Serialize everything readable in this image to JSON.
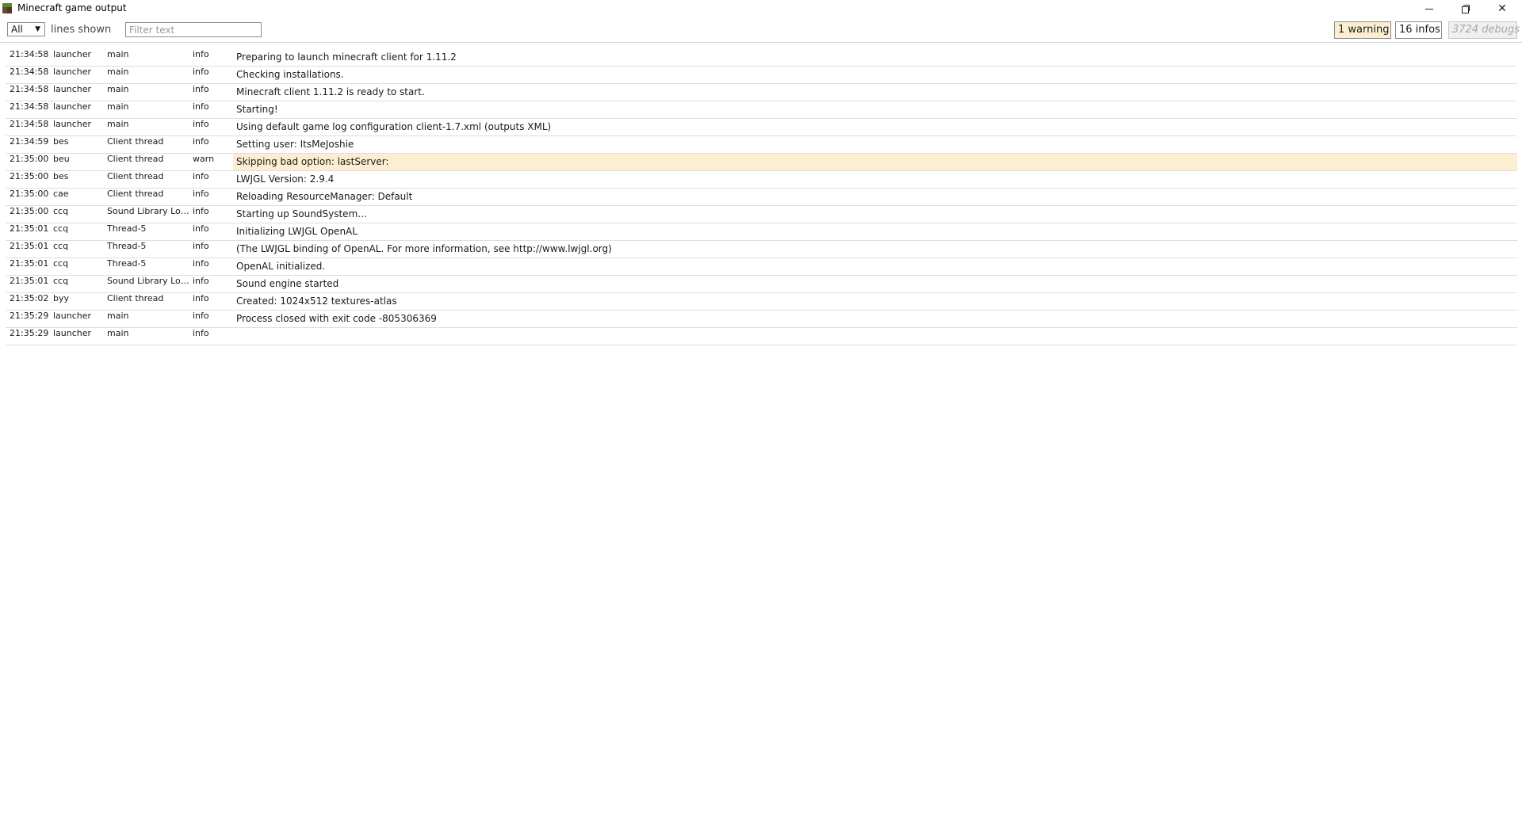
{
  "window": {
    "title": "Minecraft game output",
    "controls": {
      "minimize": "minimize",
      "restore": "restore",
      "close": "✕"
    }
  },
  "toolbar": {
    "lines_select_value": "All",
    "lines_select_arrow": "▼",
    "lines_shown_label": "lines shown",
    "filter_placeholder": "Filter text",
    "warnings_label": "1 warning",
    "infos_label": "16 infos",
    "debugs_label": "3724 debugs"
  },
  "colors": {
    "warning_highlight": "#fcefd1",
    "row_divider": "#dedede"
  },
  "log": {
    "rows": [
      {
        "time": "21:34:58",
        "source": "launcher",
        "thread": "main",
        "level": "info",
        "message": "Preparing to launch minecraft client for 1.11.2"
      },
      {
        "time": "21:34:58",
        "source": "launcher",
        "thread": "main",
        "level": "info",
        "message": "Checking installations."
      },
      {
        "time": "21:34:58",
        "source": "launcher",
        "thread": "main",
        "level": "info",
        "message": "Minecraft client 1.11.2 is ready to start."
      },
      {
        "time": "21:34:58",
        "source": "launcher",
        "thread": "main",
        "level": "info",
        "message": "Starting!"
      },
      {
        "time": "21:34:58",
        "source": "launcher",
        "thread": "main",
        "level": "info",
        "message": "Using default game log configuration client-1.7.xml (outputs XML)"
      },
      {
        "time": "21:34:59",
        "source": "bes",
        "thread": "Client thread",
        "level": "info",
        "message": "Setting user: ItsMeJoshie"
      },
      {
        "time": "21:35:00",
        "source": "beu",
        "thread": "Client thread",
        "level": "warn",
        "message": "Skipping bad option: lastServer:"
      },
      {
        "time": "21:35:00",
        "source": "bes",
        "thread": "Client thread",
        "level": "info",
        "message": "LWJGL Version: 2.9.4"
      },
      {
        "time": "21:35:00",
        "source": "cae",
        "thread": "Client thread",
        "level": "info",
        "message": "Reloading ResourceManager: Default"
      },
      {
        "time": "21:35:00",
        "source": "ccq",
        "thread": "Sound Library Loa...",
        "level": "info",
        "message": "Starting up SoundSystem..."
      },
      {
        "time": "21:35:01",
        "source": "ccq",
        "thread": "Thread-5",
        "level": "info",
        "message": "Initializing LWJGL OpenAL"
      },
      {
        "time": "21:35:01",
        "source": "ccq",
        "thread": "Thread-5",
        "level": "info",
        "message": "(The LWJGL binding of OpenAL.  For more information, see http://www.lwjgl.org)"
      },
      {
        "time": "21:35:01",
        "source": "ccq",
        "thread": "Thread-5",
        "level": "info",
        "message": "OpenAL initialized."
      },
      {
        "time": "21:35:01",
        "source": "ccq",
        "thread": "Sound Library Loa...",
        "level": "info",
        "message": "Sound engine started"
      },
      {
        "time": "21:35:02",
        "source": "byy",
        "thread": "Client thread",
        "level": "info",
        "message": "Created: 1024x512 textures-atlas"
      },
      {
        "time": "21:35:29",
        "source": "launcher",
        "thread": "main",
        "level": "info",
        "message": "Process closed with exit code -805306369"
      },
      {
        "time": "21:35:29",
        "source": "launcher",
        "thread": "main",
        "level": "info",
        "message": ""
      }
    ]
  }
}
